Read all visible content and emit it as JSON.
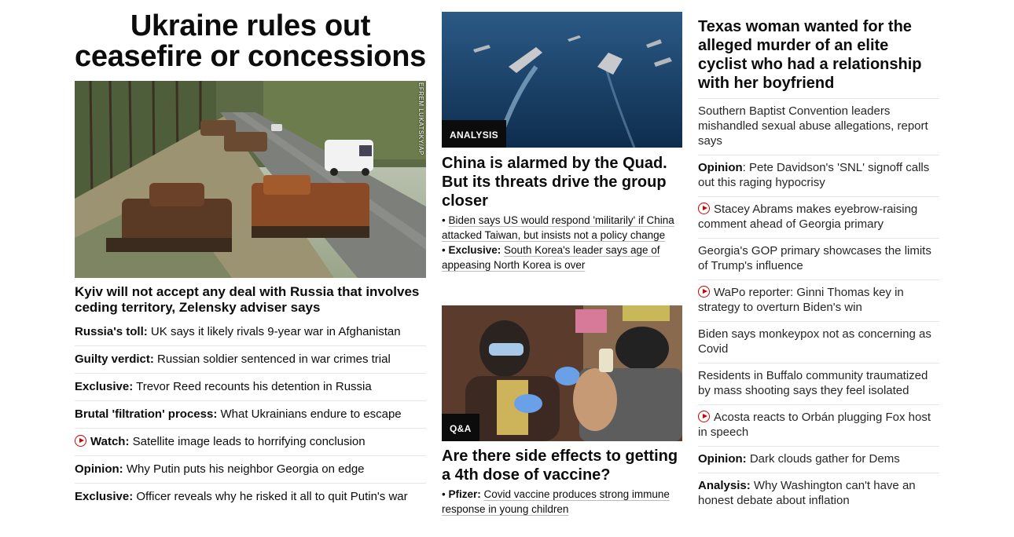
{
  "left": {
    "headline": "Ukraine rules out ceasefire or concessions",
    "photo_credit": "EFREM LUKATSKY/AP",
    "caption": "Kyiv will not accept any deal with Russia that involves ceding territory, Zelensky adviser says",
    "items": [
      {
        "bold": "Russia's toll:",
        "text": " UK says it likely rivals 9-year war in Afghanistan",
        "video": false
      },
      {
        "bold": "Guilty verdict:",
        "text": " Russian soldier sentenced in war crimes trial",
        "video": false
      },
      {
        "bold": "Exclusive:",
        "text": " Trevor Reed recounts his detention in Russia",
        "video": false
      },
      {
        "bold": "Brutal 'filtration' process:",
        "text": " What Ukrainians endure to escape",
        "video": false
      },
      {
        "bold": "Watch:",
        "text": " Satellite image leads to horrifying conclusion",
        "video": true
      },
      {
        "bold": "Opinion:",
        "text": " Why Putin puts his neighbor Georgia on edge",
        "video": false
      },
      {
        "bold": "Exclusive:",
        "text": " Officer reveals why he risked it all to quit Putin's war",
        "video": false
      }
    ]
  },
  "mid": {
    "card1": {
      "tag": "ANALYSIS",
      "headline": "China is alarmed by the Quad. But its threats drive the group closer",
      "bullet1_text": "Biden says US would respond 'militarily' if China attacked Taiwan, but insists not a policy change",
      "bullet2_bold": "Exclusive:",
      "bullet2_text": "South Korea's leader says age of appeasing North Korea is over"
    },
    "card2": {
      "tag": "Q&A",
      "headline": "Are there side effects to getting a 4th dose of vaccine?",
      "bullet1_bold": "Pfizer:",
      "bullet1_text": "Covid vaccine produces strong immune response in young children"
    }
  },
  "right": {
    "headline": "Texas woman wanted for the alleged murder of an elite cyclist who had a relationship with her boyfriend",
    "items": [
      {
        "bold": "",
        "text": "Southern Baptist Convention leaders mishandled sexual abuse allegations, report says",
        "video": false
      },
      {
        "bold": "Opinion",
        "text": ": Pete Davidson's 'SNL' signoff calls out this raging hypocrisy",
        "video": false
      },
      {
        "bold": "",
        "text": "Stacey Abrams makes eyebrow-raising comment ahead of Georgia primary",
        "video": true
      },
      {
        "bold": "",
        "text": "Georgia's GOP primary showcases the limits of Trump's influence",
        "video": false
      },
      {
        "bold": "",
        "text": "WaPo reporter: Ginni Thomas key in strategy to overturn Biden's win",
        "video": true
      },
      {
        "bold": "",
        "text": "Biden says monkeypox not as concerning as Covid",
        "video": false
      },
      {
        "bold": "",
        "text": "Residents in Buffalo community traumatized by mass shooting says they feel isolated",
        "video": false
      },
      {
        "bold": "",
        "text": "Acosta reacts to Orbán plugging Fox host in speech",
        "video": true
      },
      {
        "bold": "Opinion:",
        "text": " Dark clouds gather for Dems",
        "video": false
      },
      {
        "bold": "Analysis:",
        "text": " Why Washington can't have an honest debate about inflation",
        "video": false
      }
    ]
  },
  "colors": {
    "accent_red": "#cc0000",
    "text": "#0c0c0c",
    "divider": "#e6e6e6",
    "tag_bg": "#0c0c0c"
  },
  "icons": [
    "play-icon"
  ]
}
